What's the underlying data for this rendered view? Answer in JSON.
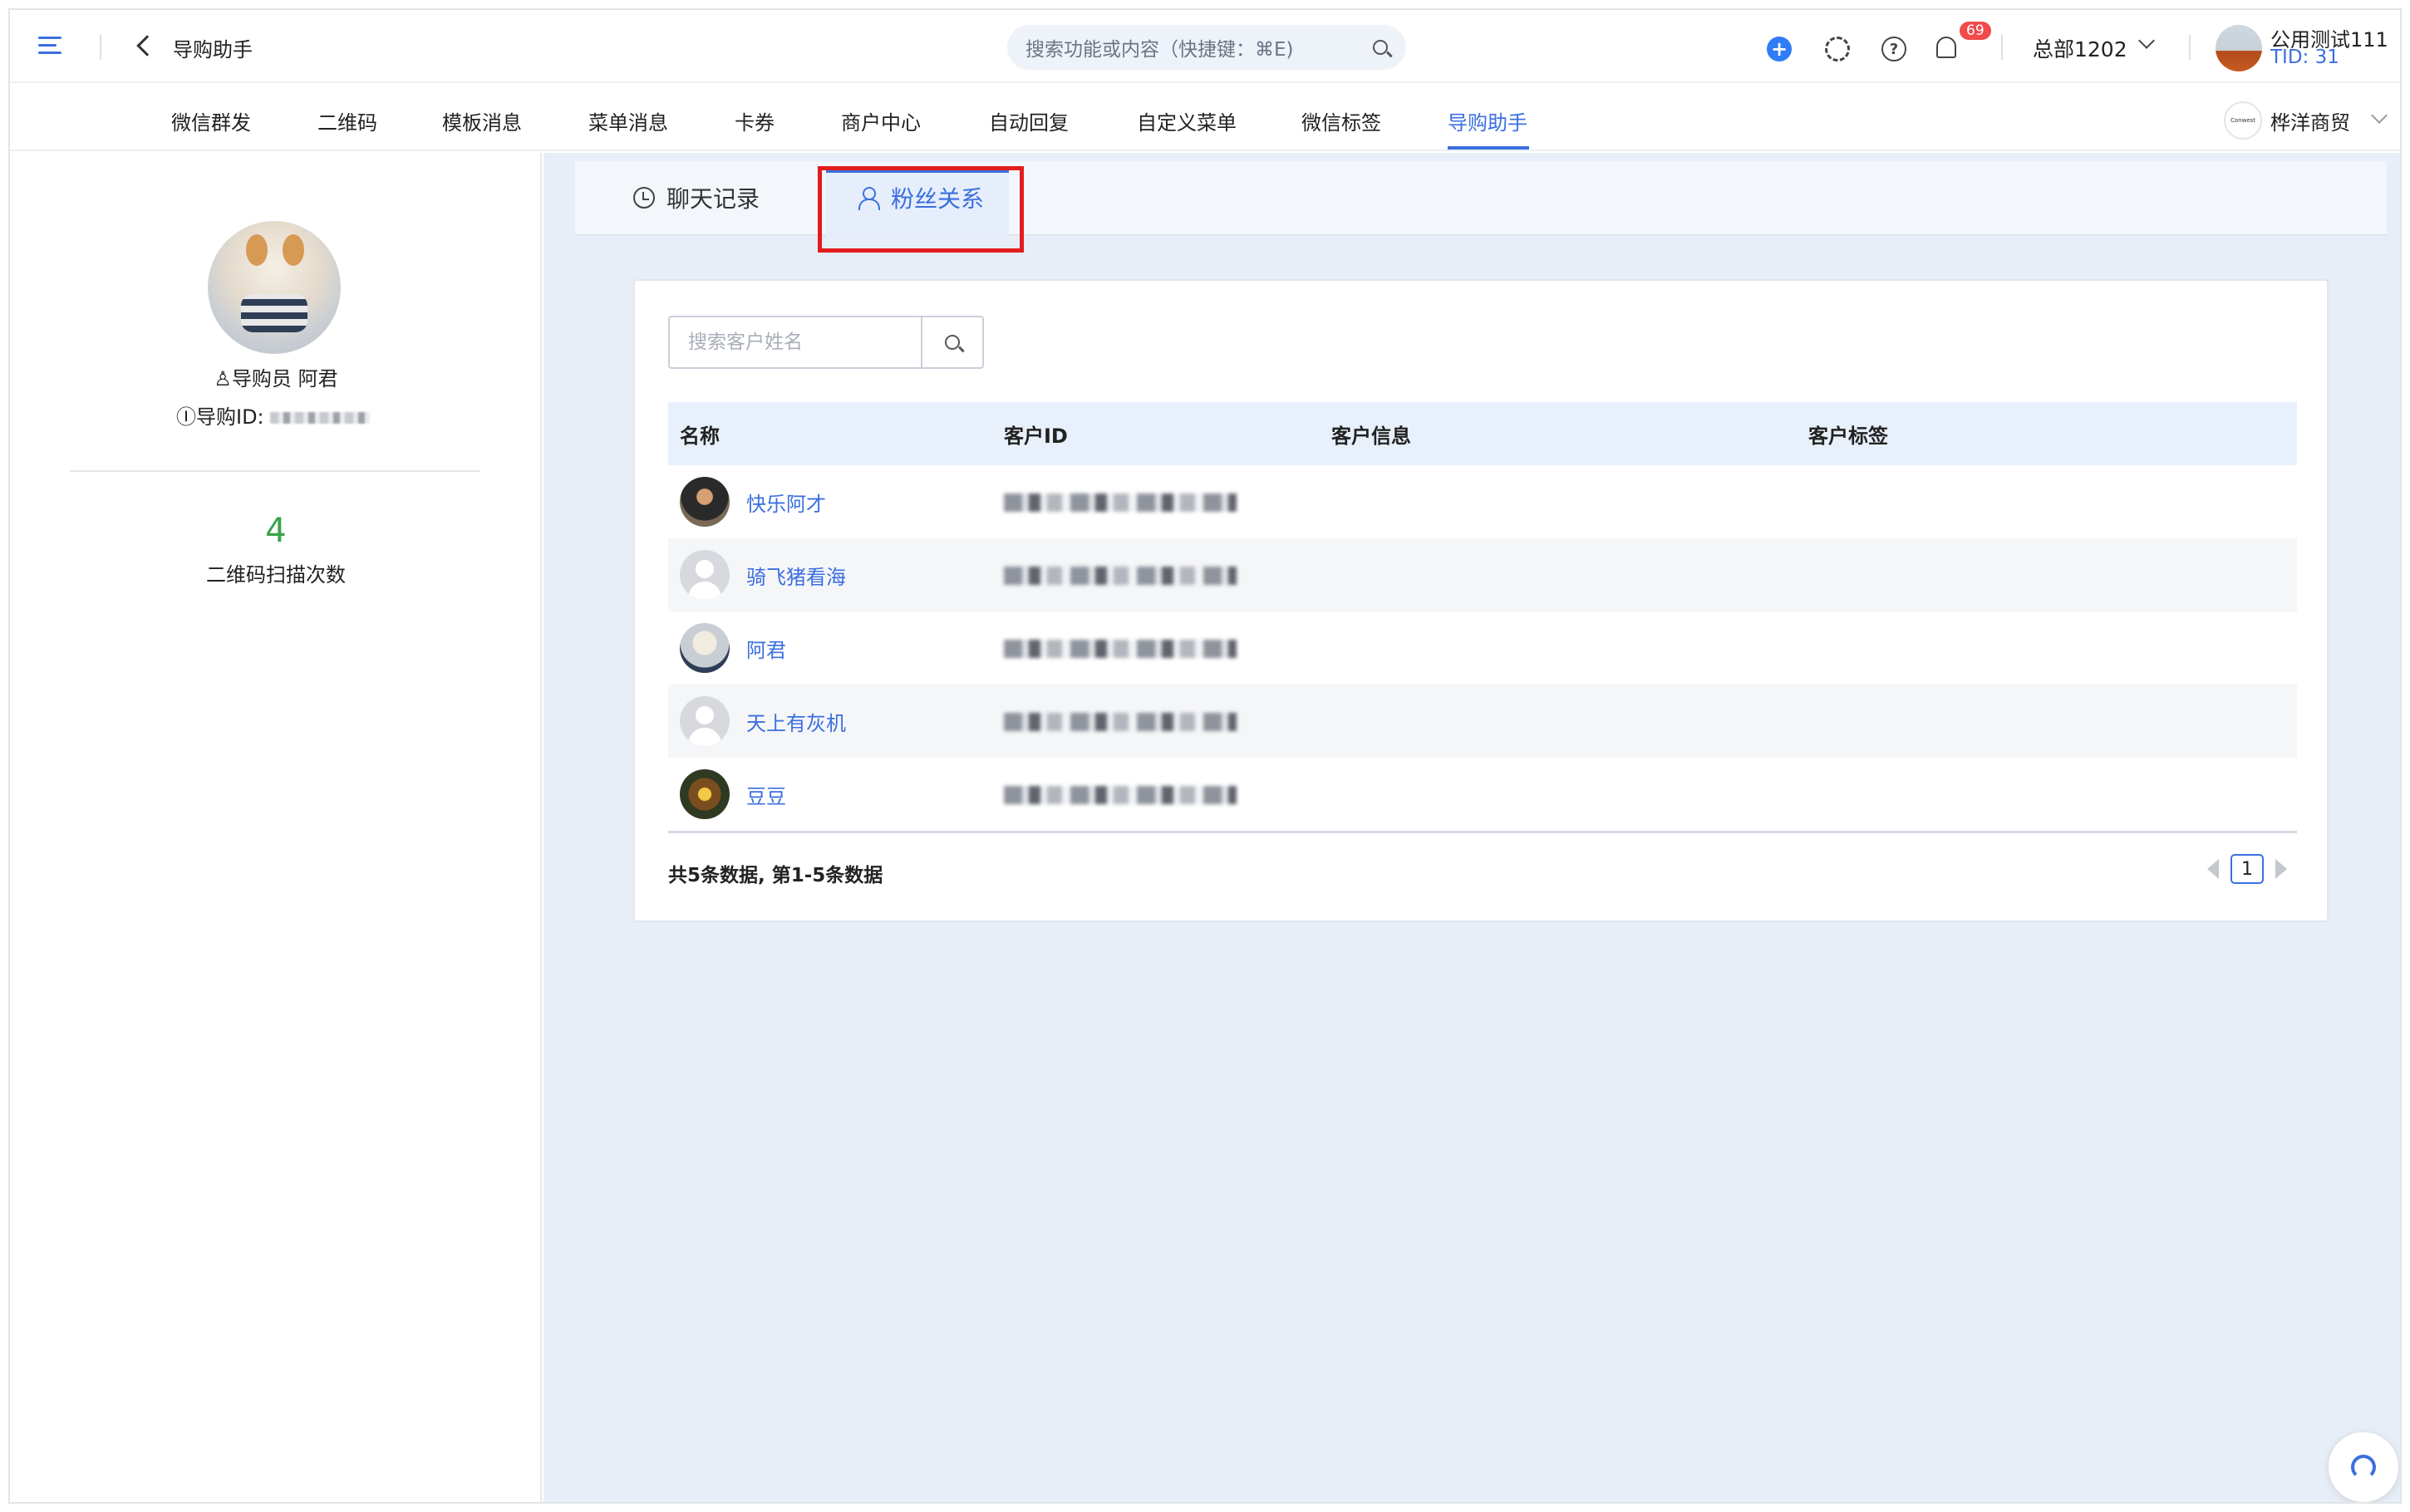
{
  "header": {
    "breadcrumb": "导购助手",
    "search_placeholder": "搜索功能或内容（快捷键：⌘E)",
    "notification_count": "69",
    "department": "总部1202",
    "user_name": "公用测试111",
    "user_tid": "TID: 31"
  },
  "nav": {
    "items": [
      "微信群发",
      "二维码",
      "模板消息",
      "菜单消息",
      "卡券",
      "商户中心",
      "自动回复",
      "自定义菜单",
      "微信标签",
      "导购助手"
    ],
    "active_index": 9,
    "company_logo_text": "Conwest",
    "company_name": "桦洋商贸"
  },
  "guide": {
    "role_name": "导购员 阿君",
    "id_label": "导购ID:",
    "stat_value": "4",
    "stat_label": "二维码扫描次数"
  },
  "tabs": {
    "chat": "聊天记录",
    "fans": "粉丝关系"
  },
  "table": {
    "search_placeholder": "搜索客户姓名",
    "headers": [
      "名称",
      "客户ID",
      "客户信息",
      "客户标签"
    ],
    "rows": [
      {
        "name": "快乐阿才",
        "avatar": "photo-avatar"
      },
      {
        "name": "骑飞猪看海",
        "avatar": "default-avatar"
      },
      {
        "name": "阿君",
        "avatar": "hamster-avatar"
      },
      {
        "name": "天上有灰机",
        "avatar": "default-avatar"
      },
      {
        "name": "豆豆",
        "avatar": "flower-avatar"
      }
    ],
    "summary": "共5条数据, 第1-5条数据",
    "current_page": "1"
  },
  "colors": {
    "accent": "#3b6fe0",
    "highlight_box": "#e31c1c",
    "stat_green": "#3aa34a",
    "badge_red": "#f04a4a"
  }
}
